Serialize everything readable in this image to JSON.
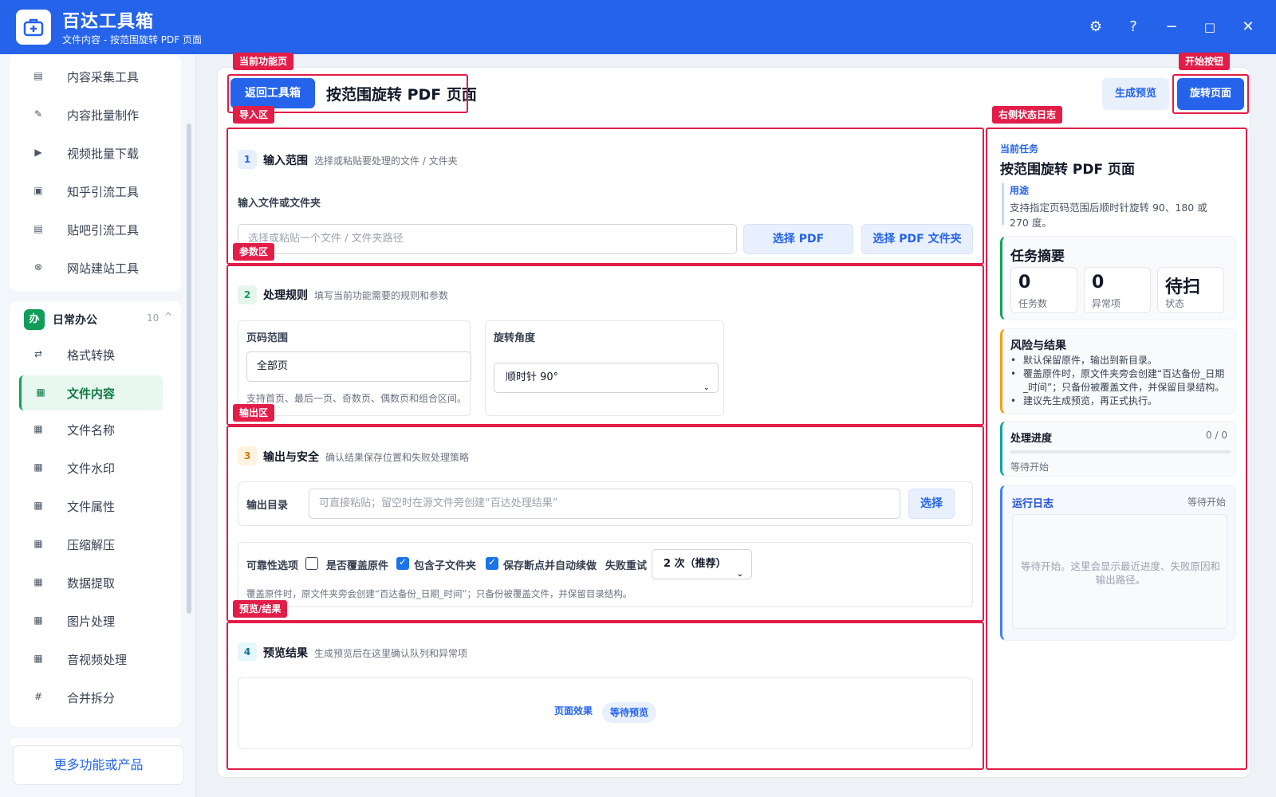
{
  "app": {
    "name": "百达工具箱",
    "subtitle": "文件内容 - 按范围旋转 PDF 页面"
  },
  "window_controls": {
    "settings": "⚙",
    "help": "?",
    "minimize": "−",
    "maximize": "□",
    "close": "✕"
  },
  "sidebar": {
    "top_items": [
      {
        "label": "内容采集工具",
        "icon": "collect-icon"
      },
      {
        "label": "内容批量制作",
        "icon": "edit-icon"
      },
      {
        "label": "视频批量下载",
        "icon": "video-icon"
      },
      {
        "label": "知乎引流工具",
        "icon": "zhihu-icon"
      },
      {
        "label": "贴吧引流工具",
        "icon": "tieba-icon"
      },
      {
        "label": "网站建站工具",
        "icon": "website-icon"
      }
    ],
    "group": {
      "badge": "办",
      "title": "日常办公",
      "count": "10",
      "caret": "^"
    },
    "group_items": [
      {
        "label": "格式转换",
        "icon": "convert-icon",
        "glyph": "⇄"
      },
      {
        "label": "文件内容",
        "icon": "grid-icon",
        "glyph": "▦",
        "active": true
      },
      {
        "label": "文件名称",
        "icon": "grid-icon",
        "glyph": "▦"
      },
      {
        "label": "文件水印",
        "icon": "grid-icon",
        "glyph": "▦"
      },
      {
        "label": "文件属性",
        "icon": "grid-icon",
        "glyph": "▦"
      },
      {
        "label": "压缩解压",
        "icon": "grid-icon",
        "glyph": "▦"
      },
      {
        "label": "数据提取",
        "icon": "grid-icon",
        "glyph": "▦"
      },
      {
        "label": "图片处理",
        "icon": "grid-icon",
        "glyph": "▦"
      },
      {
        "label": "音视频处理",
        "icon": "grid-icon",
        "glyph": "▦"
      },
      {
        "label": "合并拆分",
        "icon": "hash-icon",
        "glyph": "#"
      }
    ],
    "more_button": "更多功能或产品"
  },
  "header": {
    "back_button": "返回工具箱",
    "title": "按范围旋转 PDF 页面",
    "preview_button": "生成预览",
    "start_button": "旋转页面"
  },
  "annotations": {
    "current_page": "当前功能页",
    "start_button": "开始按钮",
    "import_area": "导入区",
    "right_log": "右侧状态日志",
    "params_area": "参数区",
    "output_area": "输出区",
    "preview_area": "预览/结果"
  },
  "step1": {
    "no": "1",
    "title": "输入范围",
    "desc": "选择或粘贴要处理的文件 / 文件夹",
    "field_label": "输入文件或文件夹",
    "placeholder": "选择或粘贴一个文件 / 文件夹路径",
    "btn_pdf": "选择 PDF",
    "btn_folder": "选择 PDF 文件夹"
  },
  "step2": {
    "no": "2",
    "title": "处理规则",
    "desc": "填写当前功能需要的规则和参数",
    "range_label": "页码范围",
    "range_value": "全部页",
    "range_hint": "支持首页、最后一页、奇数页、偶数页和组合区间。",
    "angle_label": "旋转角度",
    "angle_value": "顺时针 90°"
  },
  "step3": {
    "no": "3",
    "title": "输出与安全",
    "desc": "确认结果保存位置和失败处理策略",
    "out_label": "输出目录",
    "out_placeholder": "可直接粘贴；留空时在源文件旁创建“百达处理结果”",
    "out_button": "选择",
    "reliability_label": "可靠性选项",
    "opt_overwrite": "是否覆盖原件",
    "opt_subfolder": "包含子文件夹",
    "opt_resume": "保存断点并自动续做",
    "retry_label": "失败重试",
    "retry_value": "2 次（推荐）",
    "note": "覆盖原件时，原文件夹旁会创建“百达备份_日期_时间”；只备份被覆盖文件，并保留目录结构。"
  },
  "step4": {
    "no": "4",
    "title": "预览结果",
    "desc": "生成预览后在这里确认队列和异常项",
    "page_effect": "页面效果",
    "badge": "等待预览"
  },
  "right_panel": {
    "current_task_label": "当前任务",
    "task_title": "按范围旋转 PDF 页面",
    "purpose_label": "用途",
    "purpose_text_1": "支持指定页码范围后顺时针旋转 90、180 或",
    "purpose_text_2": "270 度。",
    "summary_title": "任务摘要",
    "stats": [
      {
        "value": "0",
        "label": "任务数"
      },
      {
        "value": "0",
        "label": "异常项"
      },
      {
        "value": "待扫",
        "label": "状态"
      }
    ],
    "risk_title": "风险与结果",
    "risk_items": [
      "默认保留原件，输出到新目录。",
      "覆盖原件时，原文件夹旁会创建“百达备份_日期",
      "_时间”；只备份被覆盖文件，并保留目录结构。",
      "建议先生成预览，再正式执行。"
    ],
    "progress_title": "处理进度",
    "progress_count": "0 / 0",
    "progress_fraction": 0,
    "progress_status": "等待开始",
    "log_title": "运行日志",
    "log_status": "等待开始",
    "log_placeholder_1": "等待开始。这里会显示最近进度、失败原因和",
    "log_placeholder_2": "输出路径。"
  },
  "colors": {
    "primary": "#2563eb",
    "accent_green": "#10a35b",
    "annotation_red": "#e11d48"
  }
}
